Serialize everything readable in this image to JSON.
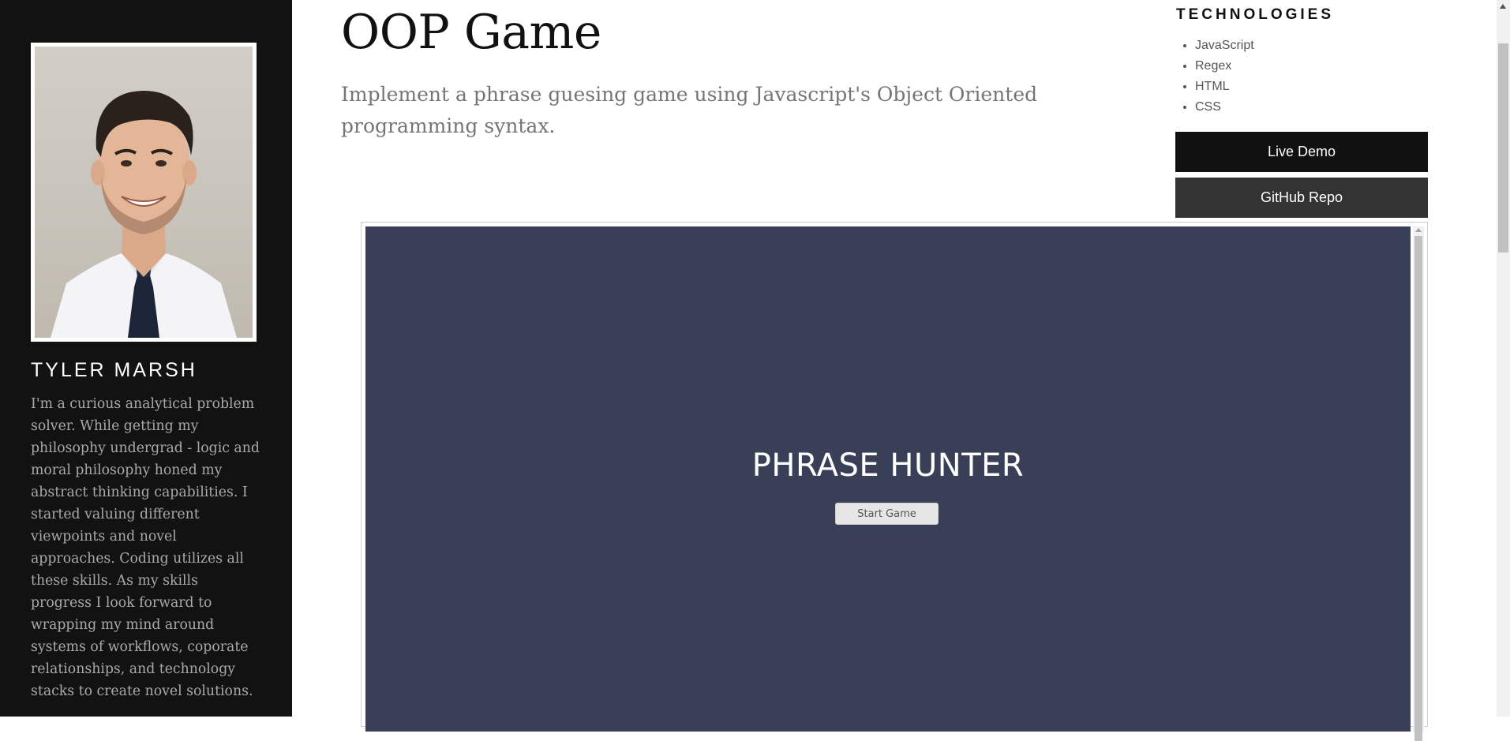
{
  "sidebar": {
    "name": "TYLER MARSH",
    "bio": "I'm a curious analytical problem solver. While getting my philosophy undergrad - logic and moral philosophy honed my abstract thinking capabilities. I started valuing different viewpoints and novel approaches. Coding utilizes all these skills. As my skills progress I look forward to wrapping my mind around systems of workflows, coporate relationships, and technology stacks to create novel solutions."
  },
  "project": {
    "title": "OOP Game",
    "description": "Implement a phrase guesing game using Javascript's Object Oriented programming syntax."
  },
  "technologies": {
    "heading": "TECHNOLOGIES",
    "items": [
      "JavaScript",
      "Regex",
      "HTML",
      "CSS"
    ]
  },
  "actions": {
    "live_demo": "Live Demo",
    "github_repo": "GitHub Repo"
  },
  "game": {
    "title": "PHRASE HUNTER",
    "start_button": "Start Game",
    "background_color": "#3a3f58"
  },
  "colors": {
    "sidebar_bg": "#121212",
    "primary_button": "#111111",
    "secondary_button": "#333333"
  }
}
